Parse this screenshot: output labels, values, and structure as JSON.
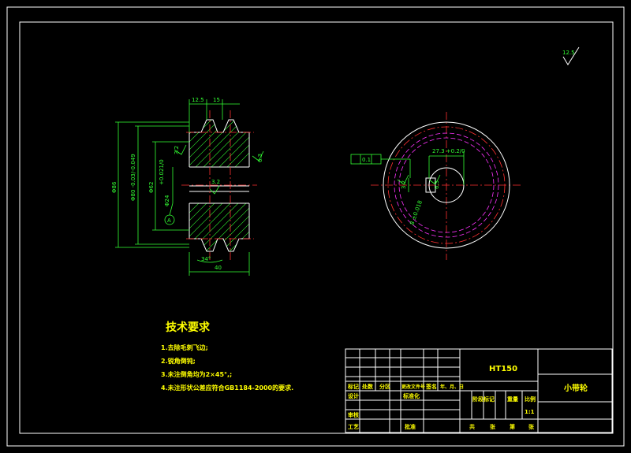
{
  "drawing": {
    "part_name": "小带轮",
    "material": "HT150",
    "surface_roughness": "12.5"
  },
  "dimensions": {
    "groove_spacing_1": "12.5",
    "groove_spacing_2": "15",
    "outer_dia": "Φ86",
    "pitch_dia": "Φ80 -0.03/-0.049",
    "hub_dia": "Φ62",
    "bore_dia": "Φ24",
    "bore_tol": "+0.021/0",
    "width": "40",
    "groove_angle": "34°",
    "keyway_depth": "27.3 +0.2/0",
    "keyway_width": "8 ±0.018",
    "roughness_groove": "3.2",
    "roughness_face": "6.3",
    "roughness_bore": "3.2",
    "roughness_key": "3.2",
    "roughness_key2": "6.3",
    "datum": "A",
    "tolerance_frame": "0.1"
  },
  "requirements": {
    "title": "技术要求",
    "items": [
      "1.去除毛刺飞边;",
      "2.锐角倒钝;",
      "3.未注倒角均为2×45°,;",
      "4.未注形状公差应符合GB1184-2000的要求."
    ]
  },
  "title_block": {
    "row_labels": [
      "标记",
      "处数",
      "分区",
      "更改文件号",
      "签名",
      "年、月、日"
    ],
    "designer": "设计",
    "standardize": "标准化",
    "review": "审核",
    "process": "工艺",
    "approve": "批准",
    "stage_mark": "阶段标记",
    "weight": "重量",
    "scale": "比例",
    "scale_value": "1:1",
    "sheets": [
      "共",
      "张",
      "第",
      "张"
    ]
  }
}
